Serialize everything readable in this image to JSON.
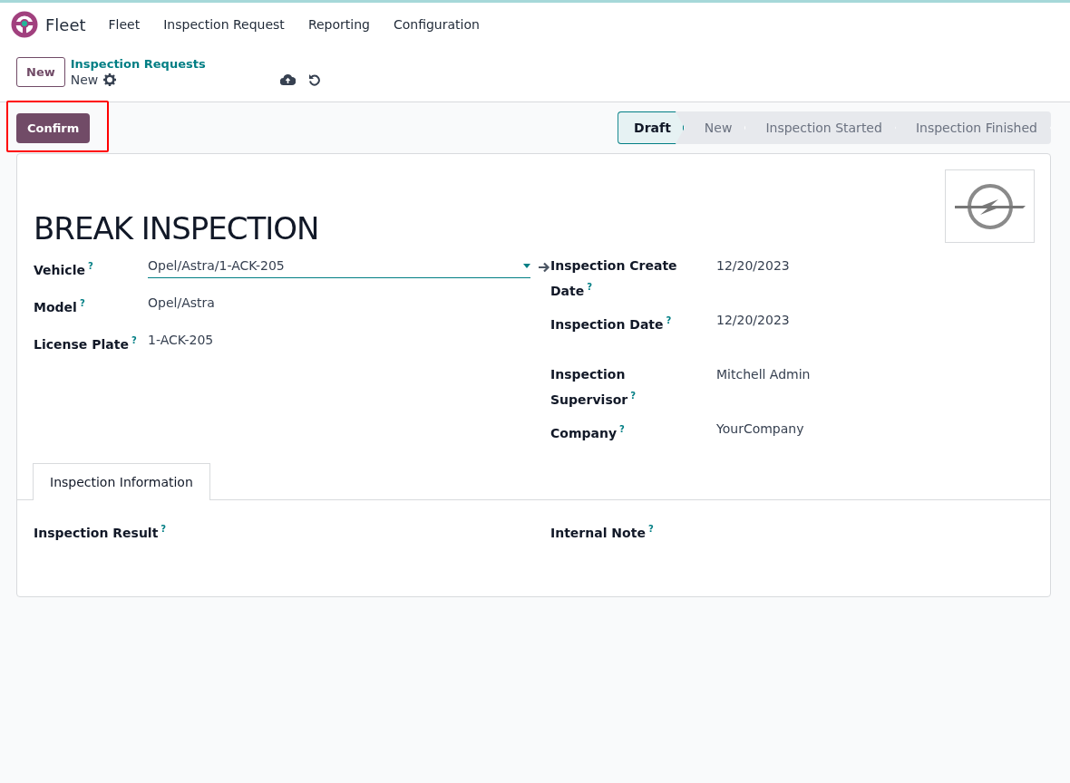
{
  "navbar": {
    "app_name": "Fleet",
    "menu": [
      "Fleet",
      "Inspection Request",
      "Reporting",
      "Configuration"
    ]
  },
  "control_panel": {
    "new_button": "New",
    "breadcrumb": "Inspection Requests",
    "record": "New"
  },
  "actions": {
    "confirm": "Confirm",
    "highlighted": true
  },
  "statusbar": [
    {
      "label": "Draft",
      "selected": true
    },
    {
      "label": "New",
      "selected": false
    },
    {
      "label": "Inspection Started",
      "selected": false
    },
    {
      "label": "Inspection Finished",
      "selected": false
    }
  ],
  "form": {
    "title": "BREAK INSPECTION",
    "left_fields": [
      {
        "label": "Vehicle",
        "help": "?",
        "value": "Opel/Astra/1-ACK-205",
        "kind": "many2one"
      },
      {
        "label": "Model",
        "help": "?",
        "value": "Opel/Astra",
        "kind": "text"
      },
      {
        "label": "License Plate",
        "help": "?",
        "value": "1-ACK-205",
        "kind": "text"
      }
    ],
    "right_fields": [
      {
        "label": "Inspection Create Date",
        "help": "?",
        "value": "12/20/2023"
      },
      {
        "label": "Inspection Date",
        "help": "?",
        "value": "12/20/2023"
      },
      {
        "label": "Inspection Supervisor",
        "help": "?",
        "value": "Mitchell Admin"
      },
      {
        "label": "Company",
        "help": "?",
        "value": "YourCompany"
      }
    ],
    "tabs": [
      {
        "label": "Inspection Information",
        "selected": true
      }
    ],
    "tab_fields": [
      {
        "label": "Inspection Result",
        "help": "?"
      },
      {
        "label": "Internal Note",
        "help": "?"
      }
    ]
  }
}
